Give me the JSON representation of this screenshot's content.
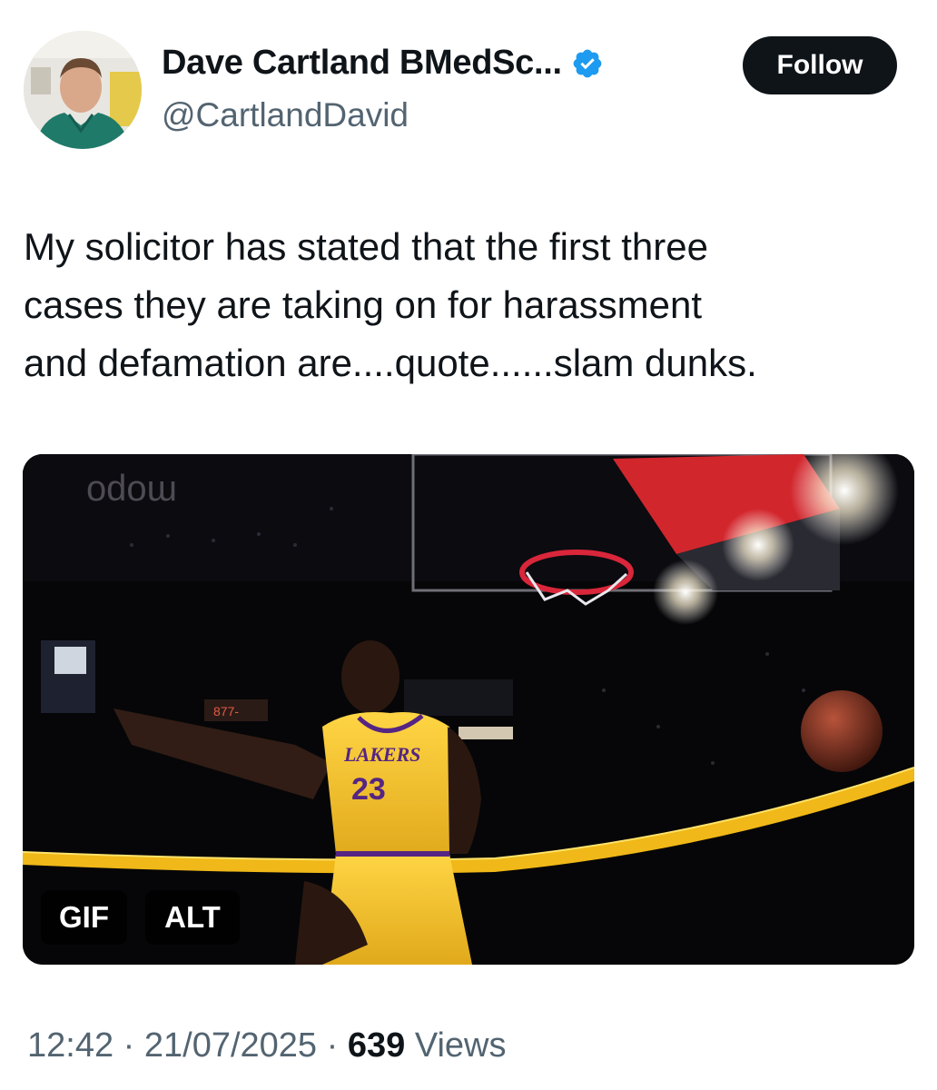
{
  "author": {
    "display_name": "Dave Cartland BMedSc...",
    "handle": "@CartlandDavid",
    "verified": true
  },
  "follow_button": {
    "label": "Follow"
  },
  "tweet": {
    "text": "My solicitor has stated that the first three\ncases they are taking on for harassment\nand defamation are....quote......slam dunks."
  },
  "media": {
    "gif_label": "GIF",
    "alt_label": "ALT",
    "jersey_team": "LAKERS",
    "jersey_number": "23"
  },
  "meta": {
    "time": "12:42",
    "separator": "·",
    "date": "21/07/2025",
    "views_count": "639",
    "views_label": "Views"
  },
  "colors": {
    "text_primary": "#0f1419",
    "text_secondary": "#536471",
    "verified_blue": "#1d9bf0",
    "button_bg": "#0f1419",
    "lakers_gold": "#f6c431",
    "lakers_purple": "#552583"
  }
}
